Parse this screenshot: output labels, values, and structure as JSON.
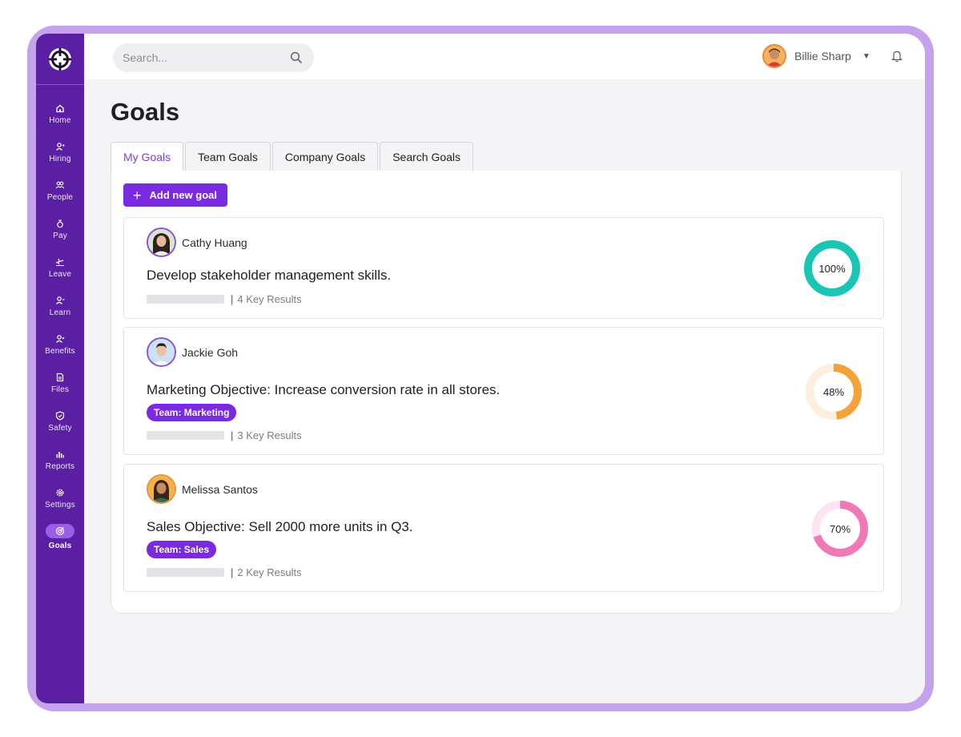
{
  "sidebar": {
    "items": [
      {
        "label": "Home",
        "icon": "home-icon"
      },
      {
        "label": "Hiring",
        "icon": "hiring-icon"
      },
      {
        "label": "People",
        "icon": "people-icon"
      },
      {
        "label": "Pay",
        "icon": "pay-icon"
      },
      {
        "label": "Leave",
        "icon": "leave-icon"
      },
      {
        "label": "Learn",
        "icon": "learn-icon"
      },
      {
        "label": "Benefits",
        "icon": "benefits-icon"
      },
      {
        "label": "Files",
        "icon": "files-icon"
      },
      {
        "label": "Safety",
        "icon": "safety-icon"
      },
      {
        "label": "Reports",
        "icon": "reports-icon"
      },
      {
        "label": "Settings",
        "icon": "settings-icon"
      },
      {
        "label": "Goals",
        "icon": "goals-icon",
        "active": true
      }
    ]
  },
  "search": {
    "placeholder": "Search..."
  },
  "user": {
    "name": "Billie Sharp"
  },
  "page": {
    "title": "Goals"
  },
  "tabs": [
    {
      "label": "My Goals",
      "active": true
    },
    {
      "label": "Team Goals"
    },
    {
      "label": "Company Goals"
    },
    {
      "label": "Search Goals"
    }
  ],
  "add_goal_label": "Add new goal",
  "goals": [
    {
      "owner": "Cathy Huang",
      "title": "Develop stakeholder management skills.",
      "key_results": "4 Key Results",
      "progress": 100,
      "progress_label": "100%",
      "color": "#19c6b3",
      "track_color": "#d6f5f1"
    },
    {
      "owner": "Jackie Goh",
      "title": "Marketing Objective: Increase conversion rate in all stores.",
      "team": "Team: Marketing",
      "key_results": "3 Key Results",
      "progress": 48,
      "progress_label": "48%",
      "color": "#f4a338",
      "track_color": "#fdeedd"
    },
    {
      "owner": "Melissa Santos",
      "title": "Sales Objective: Sell 2000 more units in Q3.",
      "team": "Team: Sales",
      "key_results": "2 Key Results",
      "progress": 70,
      "progress_label": "70%",
      "color": "#ef79b5",
      "track_color": "#fce4f0"
    }
  ],
  "colors": {
    "sidebar": "#5a1fa3",
    "accent": "#7a2ae0",
    "device_frame": "#c4a3ec"
  }
}
